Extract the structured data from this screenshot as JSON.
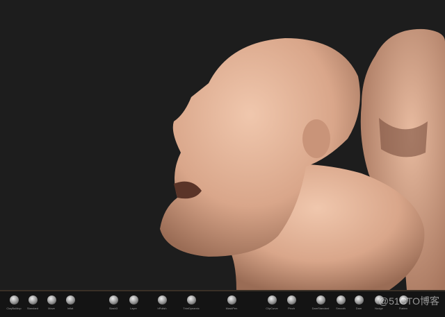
{
  "shelf": {
    "brushes": [
      {
        "label": "ClayBuildup",
        "icon": "sphere-brush-icon"
      },
      {
        "label": "Standard",
        "icon": "sphere-brush-icon"
      },
      {
        "label": "Move",
        "icon": "sphere-brush-icon"
      },
      {
        "label": "Inflat",
        "icon": "sphere-brush-icon"
      },
      {
        "label": "Slash3",
        "icon": "sphere-brush-icon"
      },
      {
        "label": "Layer",
        "icon": "sphere-brush-icon"
      },
      {
        "label": "hPolish",
        "icon": "sphere-brush-icon"
      },
      {
        "label": "TrimDynamic",
        "icon": "sphere-brush-icon"
      },
      {
        "label": "MaskPen",
        "icon": "mask-brush-icon"
      },
      {
        "label": "ClipCurve",
        "icon": "sphere-brush-icon"
      },
      {
        "label": "Pinch",
        "icon": "sphere-brush-icon"
      },
      {
        "label": "DamStandard",
        "icon": "sphere-brush-icon"
      },
      {
        "label": "Smooth",
        "icon": "sphere-brush-icon"
      },
      {
        "label": "Dam",
        "icon": "sphere-brush-icon"
      },
      {
        "label": "Nudge",
        "icon": "sphere-brush-icon"
      },
      {
        "label": "Flatten",
        "icon": "sphere-brush-icon"
      }
    ]
  },
  "watermark": "@51CTO博客"
}
